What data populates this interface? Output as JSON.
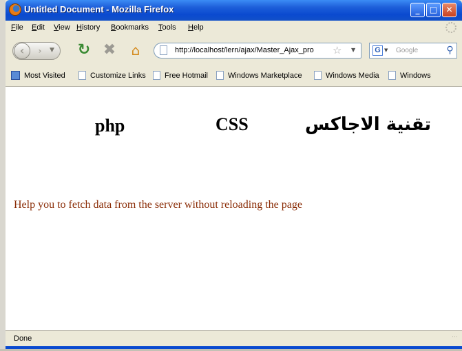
{
  "window": {
    "title": "Untitled Document - Mozilla Firefox",
    "controls": {
      "minimize": "_",
      "maximize": "□",
      "close": "✕"
    }
  },
  "menu": [
    "File",
    "Edit",
    "View",
    "History",
    "Bookmarks",
    "Tools",
    "Help"
  ],
  "nav": {
    "back_icon": "back-arrow-icon",
    "forward_icon": "forward-arrow-icon",
    "reload_icon": "reload-icon",
    "stop_icon": "stop-icon",
    "home_icon": "home-icon",
    "url": "http://localhost/lern/ajax/Master_Ajax_pro",
    "search_engine": "G",
    "search_placeholder": "Google"
  },
  "bookmarks": [
    "Most Visited",
    "Customize Links",
    "Free Hotmail",
    "Windows Marketplace",
    "Windows Media",
    "Windows"
  ],
  "page": {
    "tabs": {
      "php": "php",
      "css": "CSS",
      "ajax": "تقنية الاجاكس"
    },
    "description": "Help you to fetch data from the server without reloading the page",
    "description_color": "#8a2c06"
  },
  "status": {
    "text": "Done"
  },
  "colors": {
    "titlebar": "#0a4ad0",
    "chrome": "#ece9d8"
  }
}
